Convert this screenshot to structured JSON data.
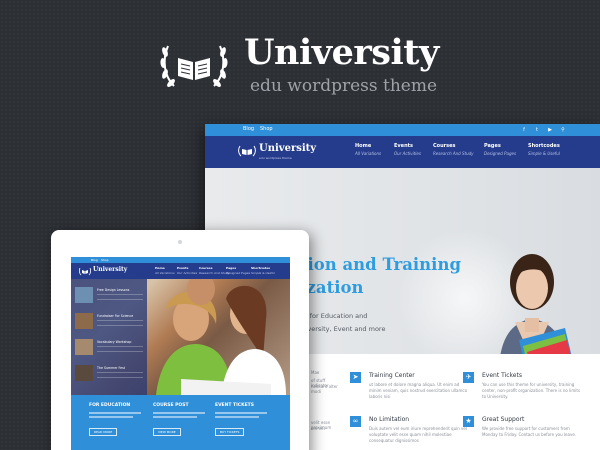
{
  "hero": {
    "title": "University",
    "subtitle": "edu wordpress theme"
  },
  "desktop": {
    "topbar": {
      "links": [
        "Blog",
        "Shop"
      ],
      "social_icons": [
        "facebook-icon",
        "twitter-icon",
        "youtube-icon",
        "search-icon"
      ]
    },
    "logo": {
      "title": "University",
      "tagline": "edu wordpress theme"
    },
    "nav": [
      {
        "label": "Home",
        "sub": "All Variations"
      },
      {
        "label": "Events",
        "sub": "Our Activities"
      },
      {
        "label": "Courses",
        "sub": "Research And Study"
      },
      {
        "label": "Pages",
        "sub": "Designed Pages"
      },
      {
        "label": "Shortcodes",
        "sub": "Simple & Useful"
      }
    ],
    "headline": "Education and Training\nOrganization",
    "description": "Responsive solution for Education and Training Center, University, Event and more ...",
    "features": [
      {
        "title": "Training Center",
        "text": "ut labore et dolore magna aliqua. Ut enim ad minim veniam, quis nostrud exercitation ullamco laboris nisi",
        "icon": "paper-plane-icon"
      },
      {
        "title": "Event Tickets",
        "text": "You can use this theme for university, training center, non-profit organization. There is no limits to University.",
        "icon": "ticket-icon"
      },
      {
        "title": "No Limitation",
        "text": "Duis autem vel eum iriure reprehenderit quin vel voluptate velit esse quam nihil molestiae consequatur dignissimos",
        "icon": "link-icon"
      },
      {
        "title": "Great Support",
        "text": "We provide free support for customers from Monday to Friday. Contact us before you leave.",
        "icon": "star-icon"
      }
    ],
    "partial_texts": [
      "Mae",
      "of stuff indicator",
      "hesitant alter modi",
      "velit esse proximum",
      "ore vel"
    ]
  },
  "tablet": {
    "topbar_links": [
      "Blog",
      "Shop"
    ],
    "logo": "University",
    "nav": [
      {
        "label": "Home",
        "sub": "All Variations"
      },
      {
        "label": "Events",
        "sub": "Our Activities"
      },
      {
        "label": "Courses",
        "sub": "Research And Study"
      },
      {
        "label": "Pages",
        "sub": "Designed Pages"
      },
      {
        "label": "Shortcodes",
        "sub": "Simple & Useful"
      }
    ],
    "sidebar_items": [
      "Free Design Lessons",
      "Fundraiser For Science",
      "Vocabulary Workshop",
      "The Summer Fest"
    ],
    "bottom": [
      {
        "heading": "FOR EDUCATION",
        "button": "READ MORE"
      },
      {
        "heading": "COURSE POST",
        "button": "VIEW MORE"
      },
      {
        "heading": "EVENT TICKETS",
        "button": "BUY TICKETS"
      }
    ]
  },
  "colors": {
    "background": "#2c2f34",
    "accent_blue": "#2f8fd8",
    "nav_navy": "#253c8c",
    "headline_blue": "#2e9de0"
  }
}
